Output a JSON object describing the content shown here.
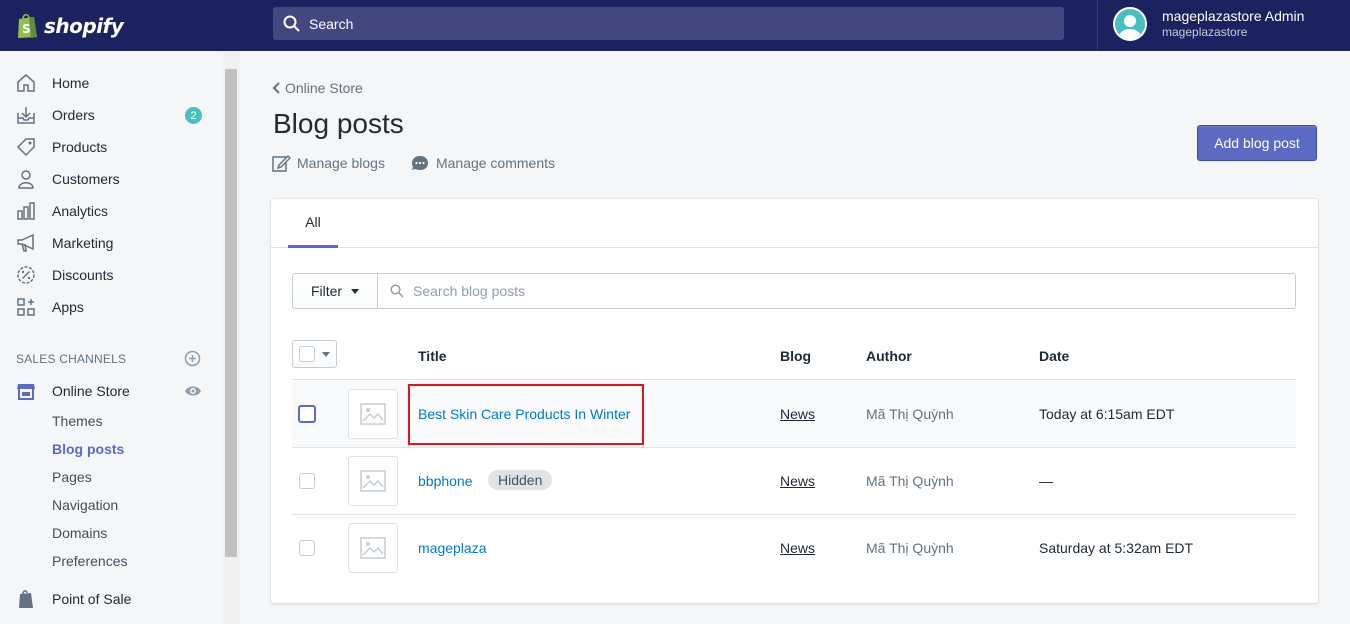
{
  "brand": {
    "name": "shopify"
  },
  "search": {
    "label": "Search"
  },
  "user": {
    "name": "mageplazastore Admin",
    "store": "mageplazastore"
  },
  "sidebar": {
    "items": [
      {
        "label": "Home",
        "icon": "home-icon"
      },
      {
        "label": "Orders",
        "icon": "orders-icon",
        "badge": "2"
      },
      {
        "label": "Products",
        "icon": "tag-icon"
      },
      {
        "label": "Customers",
        "icon": "person-icon"
      },
      {
        "label": "Analytics",
        "icon": "bar-chart-icon"
      },
      {
        "label": "Marketing",
        "icon": "megaphone-icon"
      },
      {
        "label": "Discounts",
        "icon": "discount-icon"
      },
      {
        "label": "Apps",
        "icon": "apps-icon"
      }
    ],
    "sales_channels_label": "SALES CHANNELS",
    "online_store": {
      "label": "Online Store",
      "children": [
        "Themes",
        "Blog posts",
        "Pages",
        "Navigation",
        "Domains",
        "Preferences"
      ]
    },
    "point_of_sale": "Point of Sale"
  },
  "page": {
    "breadcrumb": "Online Store",
    "title": "Blog posts",
    "actions": {
      "manage_blogs": "Manage blogs",
      "manage_comments": "Manage comments"
    },
    "add_button": "Add blog post",
    "tab_all": "All",
    "filter_label": "Filter",
    "search_placeholder": "Search blog posts",
    "columns": {
      "title": "Title",
      "blog": "Blog",
      "author": "Author",
      "date": "Date"
    },
    "rows": [
      {
        "title": "Best Skin Care Products In Winter",
        "blog": "News",
        "author": "Mã Thị Quỳnh",
        "date": "Today at 6:15am EDT",
        "badge": ""
      },
      {
        "title": "bbphone",
        "blog": "News",
        "author": "Mã Thị Quỳnh",
        "date": "—",
        "badge": "Hidden"
      },
      {
        "title": "mageplaza",
        "blog": "News",
        "author": "Mã Thị Quỳnh",
        "date": "Saturday at 5:32am EDT",
        "badge": ""
      }
    ]
  },
  "colors": {
    "topbar": "#1c2260",
    "accent": "#5c6ac4",
    "link": "#007ace",
    "highlight": "#e5121a"
  }
}
